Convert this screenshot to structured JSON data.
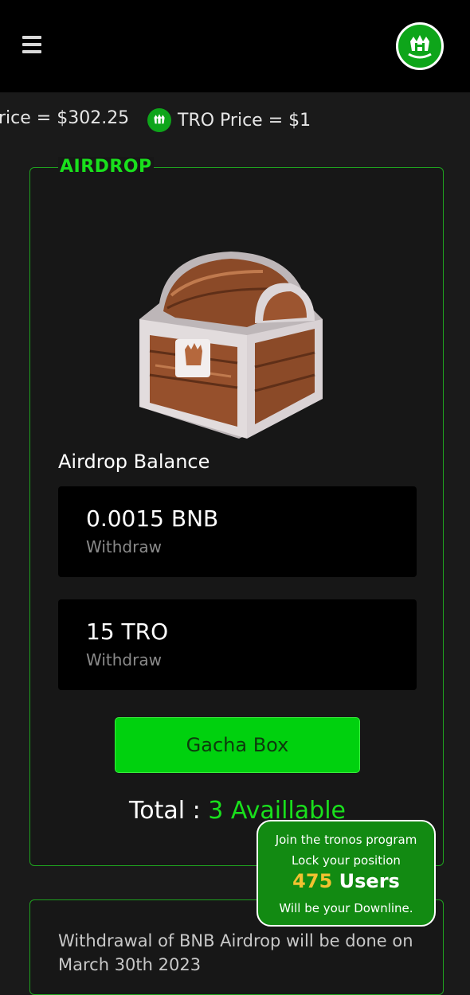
{
  "header": {
    "menu_icon": "hamburger-menu-icon",
    "logo_icon": "tronos-crown-logo-icon"
  },
  "ticker": {
    "bnb_price": "rice = $302.25",
    "tro_price": "TRO Price = $1",
    "tro_icon": "tronos-crown-logo-icon"
  },
  "airdrop": {
    "title": "AIRDROP",
    "chest_icon": "treasure-chest-icon",
    "balance_label": "Airdrop Balance",
    "balances": [
      {
        "amount": "0.0015 BNB",
        "action": "Withdraw"
      },
      {
        "amount": "15 TRO",
        "action": "Withdraw"
      }
    ],
    "gacha_label": "Gacha Box",
    "total_prefix": "Total : ",
    "total_value": "3 Availlable"
  },
  "popup": {
    "line1": "Join the tronos program",
    "line2": "Lock your position",
    "count": "475",
    "count_suffix": " Users",
    "line4": "Will be your Downline."
  },
  "notice": {
    "text": "Withdrawal of BNB Airdrop will be done on March 30th 2023"
  },
  "colors": {
    "accent_green": "#19e01c",
    "button_green": "#00d10e",
    "popup_green": "#128a12",
    "highlight_gold": "#f2c230",
    "background": "#1a1a1a"
  }
}
